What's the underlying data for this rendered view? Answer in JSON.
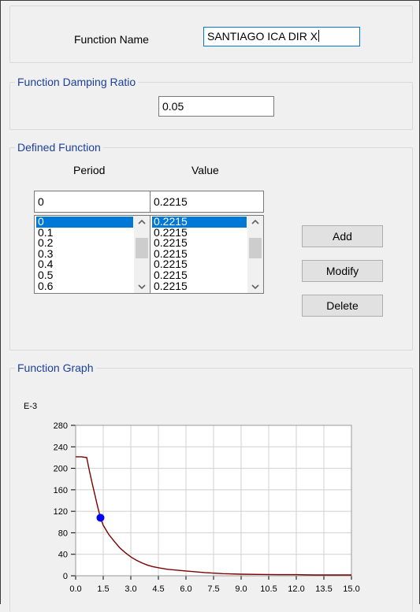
{
  "function_name": {
    "label": "Function Name",
    "value": "SANTIAGO ICA DIR X"
  },
  "damping": {
    "title": "Function Damping Ratio",
    "value": "0.05"
  },
  "defined_function": {
    "title": "Defined Function",
    "period_header": "Period",
    "value_header": "Value",
    "period_input": "0",
    "value_input": "0.2215",
    "periods": [
      "0",
      "0.1",
      "0.2",
      "0.3",
      "0.4",
      "0.5",
      "0.6"
    ],
    "values": [
      "0.2215",
      "0.2215",
      "0.2215",
      "0.2215",
      "0.2215",
      "0.2215",
      "0.2215"
    ],
    "buttons": {
      "add": "Add",
      "modify": "Modify",
      "delete": "Delete"
    }
  },
  "graph": {
    "title": "Function Graph",
    "colors": {
      "curve": "#7b0000",
      "marker": "#0000ff",
      "grid": "#d0d0d0"
    },
    "chart_data": {
      "type": "line",
      "y_multiplier_label": "E-3",
      "xlim": [
        0,
        15
      ],
      "ylim": [
        0,
        280
      ],
      "x_ticks": [
        "0.0",
        "1.5",
        "3.0",
        "4.5",
        "6.0",
        "7.5",
        "9.0",
        "10.5",
        "12.0",
        "13.5",
        "15.0"
      ],
      "y_ticks": [
        "0",
        "40",
        "80",
        "120",
        "160",
        "200",
        "240",
        "280"
      ],
      "series": [
        {
          "x": [
            0,
            0.3,
            0.6,
            0.75,
            0.9,
            1.05,
            1.2,
            1.35,
            1.5,
            1.8,
            2.1,
            2.4,
            2.7,
            3.0,
            3.3,
            3.6,
            3.9,
            4.2,
            4.5,
            5.0,
            6.0,
            7.0,
            8.0,
            9.0,
            10.0,
            11.0,
            12.0,
            13.0,
            14.0,
            15.0
          ],
          "y": [
            221.5,
            221.5,
            220,
            195,
            172,
            150,
            128,
            108,
            94,
            77,
            64,
            52,
            43,
            35,
            29,
            24,
            20,
            17,
            15,
            12,
            9,
            6,
            4,
            3,
            2.5,
            2,
            2,
            1.5,
            1.5,
            1.5
          ]
        }
      ],
      "marker": {
        "x": 1.35,
        "y": 108
      }
    }
  }
}
